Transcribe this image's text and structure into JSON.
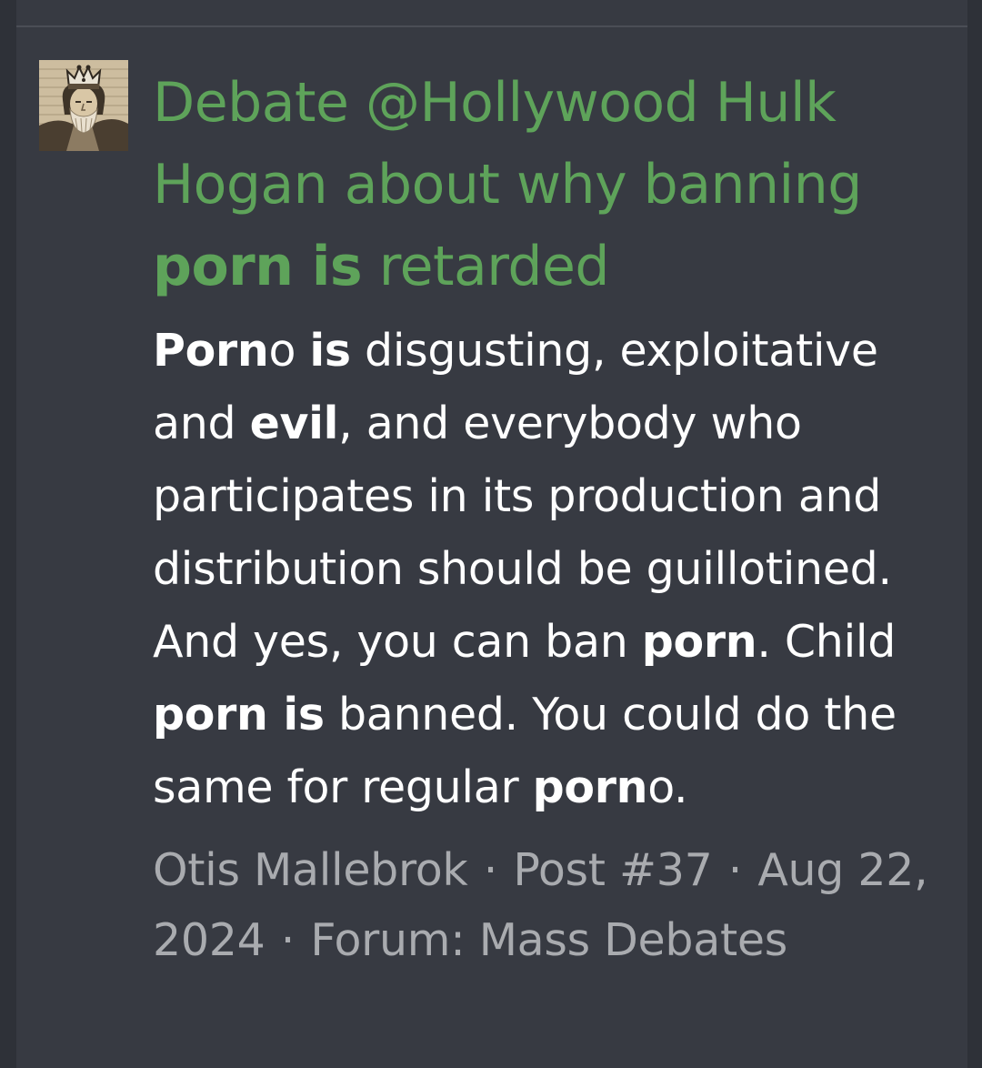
{
  "result": {
    "title": {
      "seg1": "Debate @Hollywood Hulk Hogan about why banning ",
      "hl1": "porn is",
      "seg2": " retarded"
    },
    "snippet": {
      "hl_porn_a": "Porn",
      "t1": "o ",
      "hl_is_a": "is",
      "t2": " disgusting, exploitative and ",
      "hl_evil": "evil",
      "t3": ", and everybody who participates in its production and distribution should be guillotined. And yes, you can ban ",
      "hl_porn_b": "porn",
      "t4": ". Child ",
      "hl_porn_is": "porn is",
      "t5": " banned. You could do the same for regular ",
      "hl_porn_c": "porn",
      "t6": "o."
    },
    "meta": {
      "author": "Otis Mallebrok",
      "separator": "·",
      "post": "Post #37",
      "date": "Aug 22, 2024",
      "forum": "Forum: Mass Debates"
    },
    "avatar_icon": "crowned-king-portrait-icon"
  },
  "colors": {
    "background": "#2e3138",
    "card": "#373a42",
    "title": "#5ea35a",
    "snippet": "#ffffff",
    "meta": "#a9abaf"
  }
}
